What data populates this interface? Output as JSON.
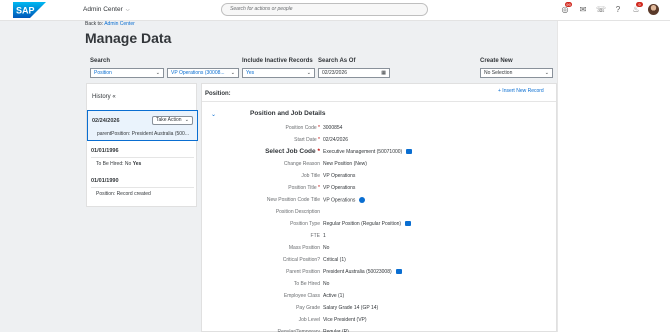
{
  "shell": {
    "app_name": "Admin Center",
    "search_placeholder": "Search for actions or people",
    "notification_count": "99",
    "alert_count": "9",
    "brand_color": "#0a6ed1"
  },
  "page": {
    "back_prefix": "Back to:",
    "back_link": "Admin Center",
    "title": "Manage Data"
  },
  "filters": {
    "search_label": "Search",
    "search_type": "Position",
    "search_value": "VP Operations (30008...",
    "inactive_label": "Include Inactive Records",
    "inactive_value": "Yes",
    "asof_label": "Search As Of",
    "asof_value": "02/23/2026",
    "create_label": "Create New",
    "create_value": "No Selection"
  },
  "history": {
    "title": "History «",
    "selected_date": "02/24/2026",
    "take_action": "Take Action",
    "selected_text": "parentPosition: President Australia (500...",
    "entries": [
      {
        "date": "01/01/1996",
        "text_prefix": "To Be Hired: No ",
        "text_bold": "Yes"
      },
      {
        "date": "01/01/1990",
        "text": "Position: Record created"
      }
    ]
  },
  "main": {
    "header": "Position:",
    "insert_label": "+  Insert New Record",
    "section_title": "Position and Job Details",
    "fields": [
      {
        "label": "Position Code",
        "required": true,
        "value": "3000854"
      },
      {
        "label": "Start Date",
        "required": true,
        "value": "02/24/2026"
      },
      {
        "label": "Select Job Code",
        "required": true,
        "value": "Executive Management (50071000)"
      },
      {
        "label": "Change Reason",
        "value": "New Position (New)"
      },
      {
        "label": "Job Title",
        "value": "VP Operations"
      },
      {
        "label": "Position Title",
        "required": true,
        "value": "VP Operations"
      },
      {
        "label": "New Position Code Title",
        "value": "VP Operations"
      },
      {
        "label": "Position Description",
        "value": ""
      },
      {
        "label": "Position Type",
        "value": "Regular Position (Regular Position)"
      },
      {
        "label": "FTE",
        "value": "1"
      },
      {
        "label": "Mass Position",
        "value": "No"
      },
      {
        "label": "Critical Position?",
        "value": "Critical (1)"
      },
      {
        "label": "Parent Position",
        "value": "President Australia (50023008)"
      },
      {
        "label": "To Be Hired",
        "value": "No"
      },
      {
        "label": "Employee Class",
        "value": "Active (1)"
      },
      {
        "label": "Pay Grade",
        "value": "Salary Grade 14 (GP 14)"
      },
      {
        "label": "Job Level",
        "value": "Vice President (VP)"
      },
      {
        "label": "Regular/Temporary",
        "value": "Regular (R)"
      }
    ]
  }
}
